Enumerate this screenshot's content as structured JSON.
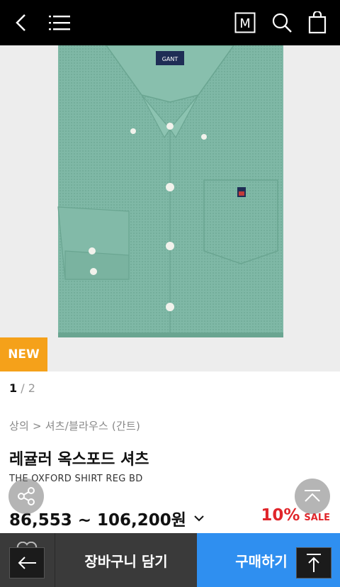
{
  "topbar": {
    "back_icon": "chevron-left-icon",
    "menu_icon": "hamburger-icon",
    "m_badge": "M",
    "search_icon": "search-icon",
    "bag_icon": "shopping-bag-icon"
  },
  "hero": {
    "badge": "NEW",
    "logo_text": "GANT",
    "shirt_color": "#7fb8a6"
  },
  "pager": {
    "current": "1",
    "separator": "/",
    "total": "2"
  },
  "breadcrumb": "상의 > 셔츠/블라우스 (간트)",
  "product": {
    "title": "레귤러 옥스포드 셔츠",
    "subtitle": "THE OXFORD SHIRT REG BD",
    "price_range": "86,553 ~ 106,200원",
    "discount": "10%",
    "sale_label": "SALE"
  },
  "bottom": {
    "cart_label": "장바구니 담기",
    "buy_label": "구매하기",
    "cart_color": "#3a3a3a",
    "buy_color": "#2f8ff0"
  },
  "colors": {
    "accent_badge": "#f5a11a",
    "discount": "#e0262b"
  }
}
